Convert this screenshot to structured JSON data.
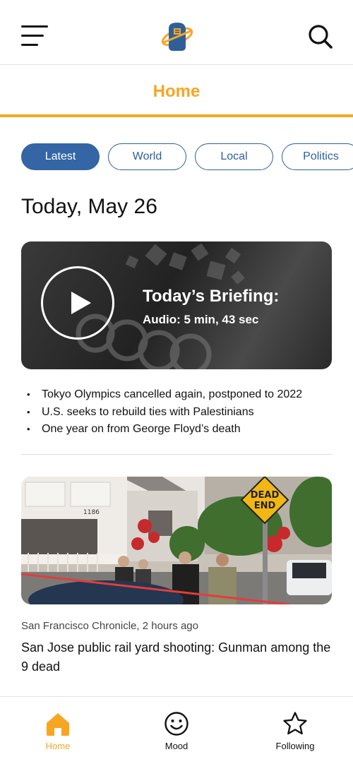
{
  "header": {
    "menu_icon": "hamburger-menu-icon",
    "logo_icon": "globe-logo-icon",
    "search_icon": "search-icon"
  },
  "title_bar": {
    "title": "Home",
    "accent": "#f6a623"
  },
  "filters": {
    "chips": [
      {
        "label": "Latest",
        "active": true
      },
      {
        "label": "World",
        "active": false
      },
      {
        "label": "Local",
        "active": false
      },
      {
        "label": "Politics",
        "active": false
      }
    ],
    "active_color": "#3465a4"
  },
  "date_heading": "Today, May 26",
  "briefing": {
    "title": "Today’s Briefing:",
    "subtitle": "Audio: 5 min, 43 sec",
    "play_icon": "play-icon",
    "bullets": [
      "Tokyo Olympics cancelled again, postponed to 2022",
      "U.S. seeks to rebuild ties with Palestinians",
      "One year on from George Floyd’s death"
    ]
  },
  "article": {
    "sign_text": [
      "DEAD",
      "END"
    ],
    "house_number": "1186",
    "source": "San Francisco Chronicle, 2 hours ago",
    "headline": "San Jose public rail yard shooting: Gunman among the 9 dead"
  },
  "bottom_nav": {
    "items": [
      {
        "label": "Home",
        "icon": "home-icon",
        "active": true
      },
      {
        "label": "Mood",
        "icon": "smiley-icon",
        "active": false
      },
      {
        "label": "Following",
        "icon": "star-icon",
        "active": false
      }
    ]
  }
}
